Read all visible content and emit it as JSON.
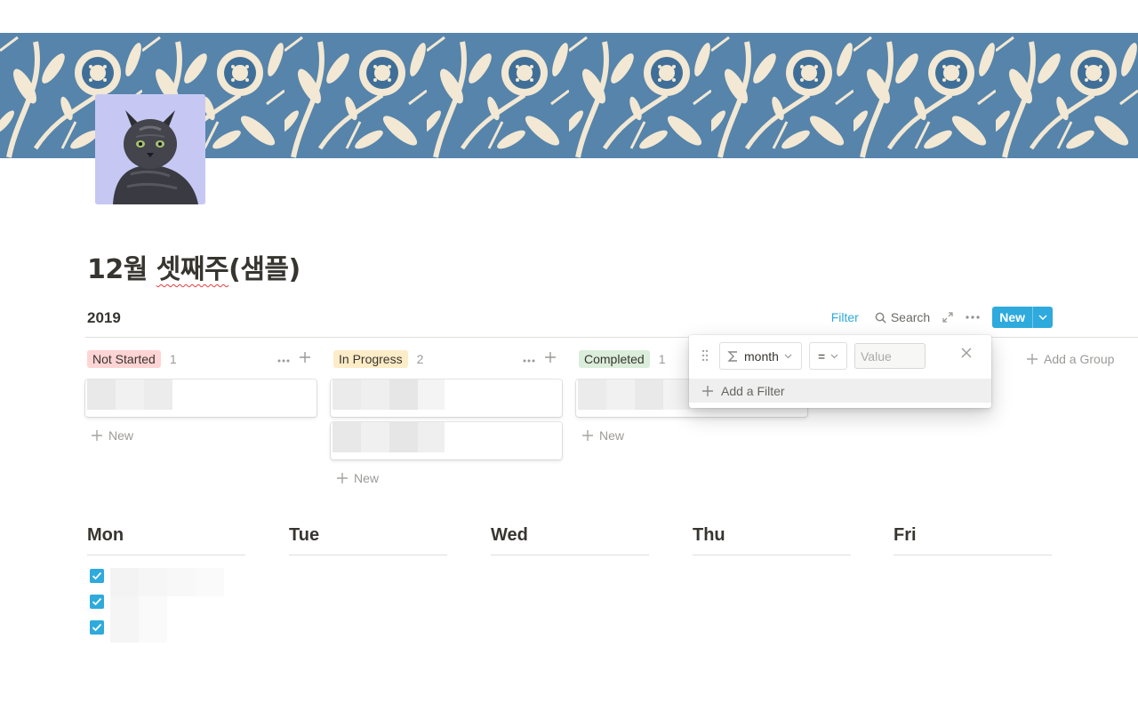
{
  "page": {
    "title_main": "12월 ",
    "title_spell": "셋째주",
    "title_rest": "(샘플)"
  },
  "database": {
    "title": "2019",
    "toolbar": {
      "filter_label": "Filter",
      "search_label": "Search",
      "new_label": "New"
    },
    "columns": [
      {
        "label": "Not Started",
        "count": "1",
        "tag_color": "#ffcccc",
        "new_label": "New"
      },
      {
        "label": "In Progress",
        "count": "2",
        "tag_color": "#fdecc8",
        "new_label": "New"
      },
      {
        "label": "Completed",
        "count": "1",
        "tag_color": "#dbeddb",
        "new_label": "New"
      }
    ],
    "add_group_label": "Add a Group"
  },
  "filter_popup": {
    "property": "month",
    "operator": "=",
    "value_placeholder": "Value",
    "add_filter_label": "Add a Filter"
  },
  "week": {
    "days": [
      "Mon",
      "Tue",
      "Wed",
      "Thu",
      "Fri"
    ]
  },
  "colors": {
    "accent": "#2eaadc",
    "text": "#37352f"
  },
  "icons": [
    "cat-photo-icon",
    "search-icon",
    "expand-icon",
    "more-icon",
    "plus-icon",
    "chevron-down-icon",
    "sigma-icon",
    "drag-handle-icon",
    "close-icon",
    "checkbox-checked-icon"
  ]
}
